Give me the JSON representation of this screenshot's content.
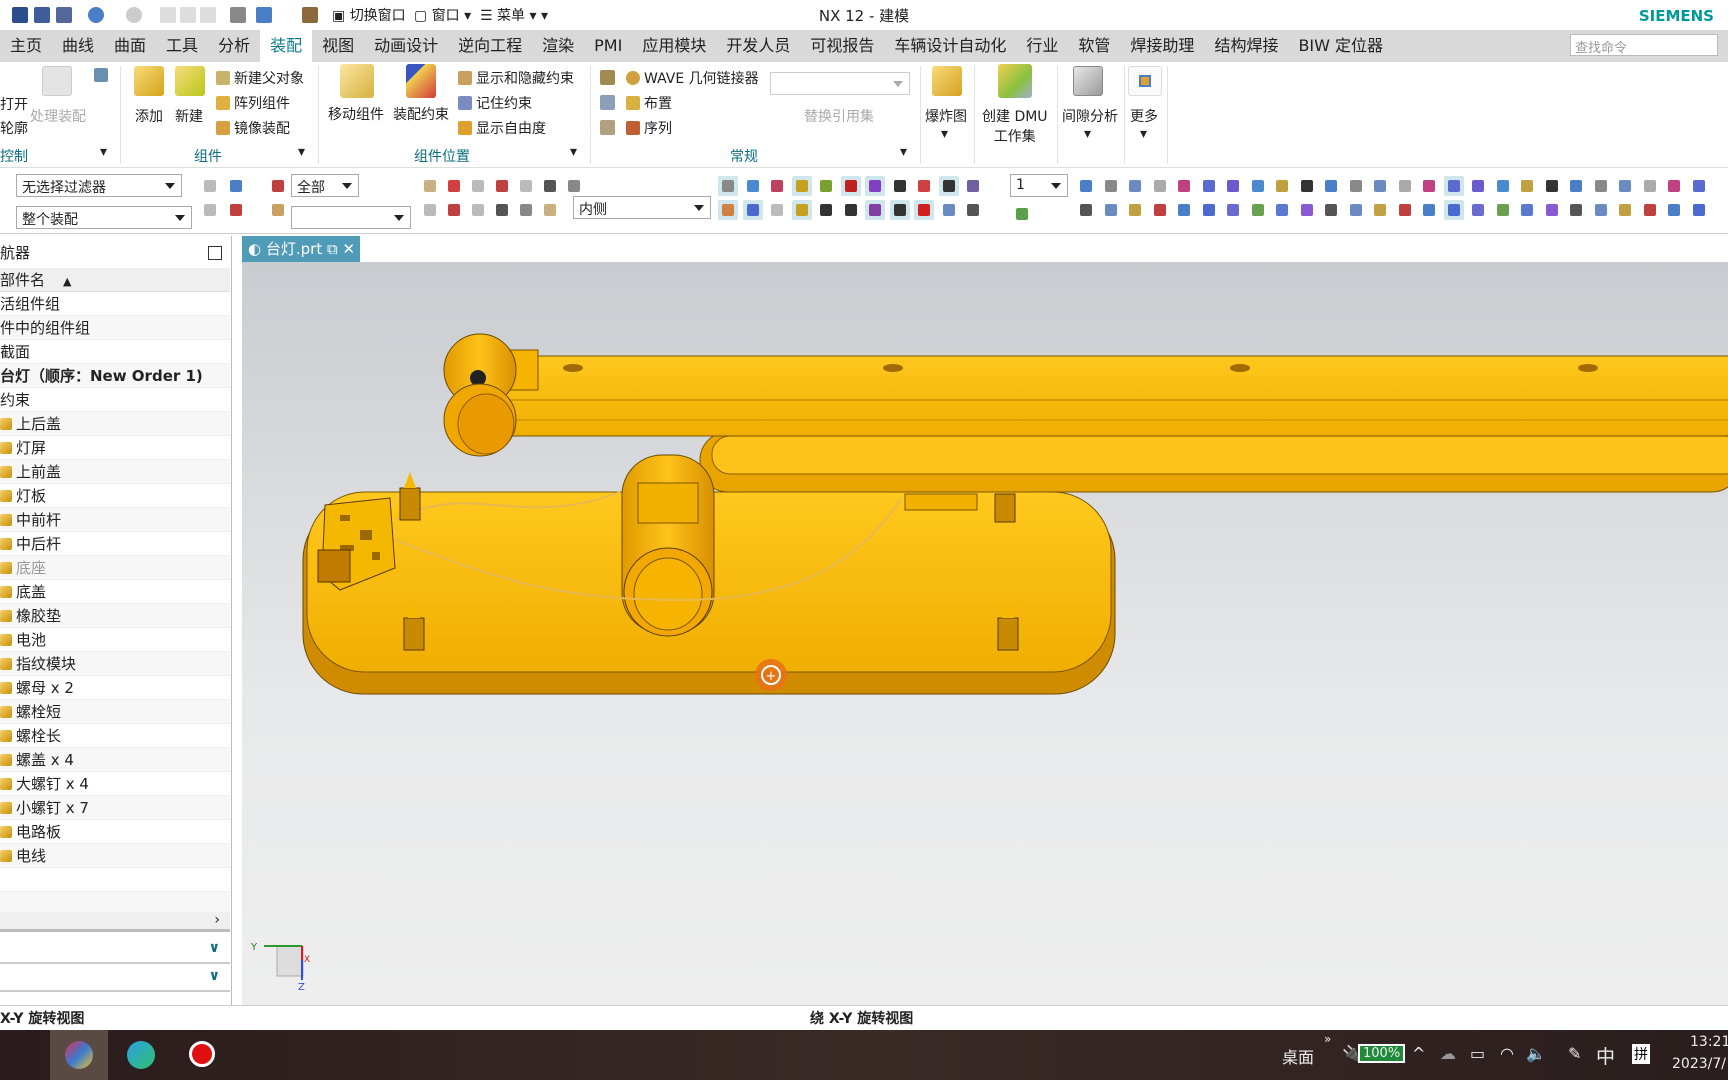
{
  "app": {
    "title": "NX 12 - 建模",
    "brand": "SIEMENS"
  },
  "quick_access": {
    "switch_window": "切换窗口",
    "window": "窗口",
    "menu": "菜单"
  },
  "tabs": [
    "主页",
    "曲线",
    "曲面",
    "工具",
    "分析",
    "装配",
    "视图",
    "动画设计",
    "逆向工程",
    "渲染",
    "PMI",
    "应用模块",
    "开发人员",
    "可视报告",
    "车辆设计自动化",
    "行业",
    "软管",
    "焊接助理",
    "结构焊接",
    "BIW 定位器"
  ],
  "active_tab": "装配",
  "search": {
    "placeholder": "查找命令"
  },
  "ribbon": {
    "g1": {
      "open": "打开",
      "outline": "轮廓",
      "process": "处理装配",
      "label": "控制"
    },
    "g2": {
      "add": "添加",
      "new": "新建",
      "new_parent": "新建父对象",
      "array": "阵列组件",
      "mirror": "镜像装配",
      "label": "组件"
    },
    "g3": {
      "move": "移动组件",
      "constraint": "装配约束",
      "show_hide": "显示和隐藏约束",
      "remember": "记住约束",
      "dof": "显示自由度",
      "label": "组件位置"
    },
    "g4": {
      "wave": "WAVE 几何链接器",
      "layout": "布置",
      "sequence": "序列",
      "replace_ref": "替换引用集",
      "label": "常规"
    },
    "g5": {
      "exploded": "爆炸图",
      "dmu": "创建 DMU",
      "dmu2": "工作集",
      "clearance": "间隙分析",
      "more": "更多"
    }
  },
  "toolbar": {
    "filter": "无选择过滤器",
    "scope": "整个装配",
    "type": "全部",
    "type2": "",
    "inside": "内侧",
    "layer": "1"
  },
  "navigator": {
    "title": "航器",
    "column": "部件名",
    "rows": [
      "活组件组",
      "件中的组件组",
      "截面",
      "台灯（顺序：New Order 1)",
      "约束"
    ],
    "parts": [
      "上后盖",
      "灯屏",
      "上前盖",
      "灯板",
      "中前杆",
      "中后杆",
      "底座",
      "底盖",
      "橡胶垫",
      "电池",
      "指纹模块",
      "螺母 x 2",
      "螺栓短",
      "螺栓长",
      "螺盖 x 4",
      "大螺钉 x 4",
      "小螺钉 x 7",
      "电路板",
      "电线"
    ],
    "suppressed": "底座"
  },
  "doc_tab": "台灯.prt",
  "status": {
    "left": "X-Y 旋转视图",
    "center": "绕 X-Y 旋转视图"
  },
  "triad": {
    "y": "Y",
    "x": "X",
    "z": "Z"
  },
  "taskbar": {
    "desktop": "桌面",
    "battery": "100%",
    "ime1": "中",
    "ime2": "拼",
    "time": "13:21",
    "date": "2023/7/"
  },
  "colors": {
    "accent": "#0a7c8c",
    "model": "#f5b400",
    "tab": "#4f9bb8"
  }
}
